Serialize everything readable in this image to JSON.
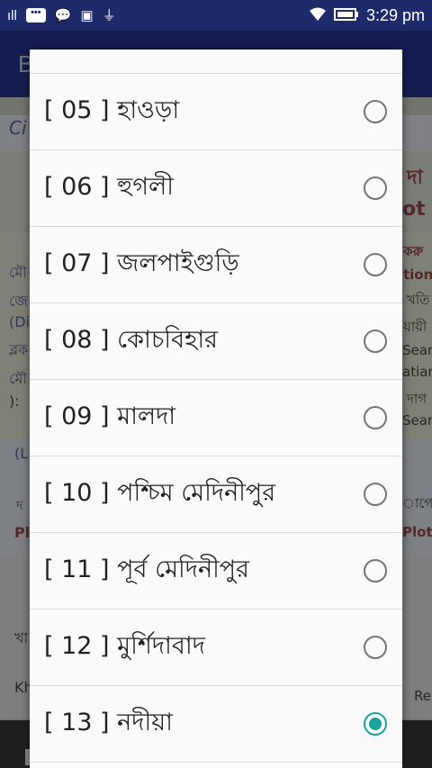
{
  "status_bar": {
    "time": "3:29 pm",
    "icons": [
      "signal-icon",
      "message-icon",
      "chat-icon",
      "image-icon",
      "usb-icon",
      "wifi-icon",
      "battery-icon"
    ]
  },
  "app_bar": {
    "title": "B"
  },
  "dialog": {
    "options": [
      {
        "label": "[ 05 ] হাওড়া",
        "selected": false
      },
      {
        "label": "[ 06 ] হুগলী",
        "selected": false
      },
      {
        "label": "[ 07 ] জলপাইগুড়ি",
        "selected": false
      },
      {
        "label": "[ 08 ] কোচবিহার",
        "selected": false
      },
      {
        "label": "[ 09 ] মালদা",
        "selected": false
      },
      {
        "label": "[ 10 ] পশ্চিম মেদিনীপুর",
        "selected": false
      },
      {
        "label": "[ 11 ] পূর্ব মেদিনীপুর",
        "selected": false
      },
      {
        "label": "[ 12 ] মুর্শিদাবাদ",
        "selected": false
      },
      {
        "label": "[ 13 ] নদীয়া",
        "selected": true
      }
    ],
    "accent_color": "#1aa39a"
  },
  "background": {
    "fragments": [
      "Ci",
      "দা",
      "ot",
      "মৌ",
      "জে",
      "(Di",
      "ব্লক",
      "মৌ",
      "):",
      "(L",
      "দ",
      "Pl",
      "খা",
      "Kh",
      "করু",
      "tion",
      "খতি",
      "য়ায়ী",
      "Sear",
      "atian",
      "দাগ",
      "Sear",
      "াগের",
      "Plot",
      "Re"
    ]
  }
}
